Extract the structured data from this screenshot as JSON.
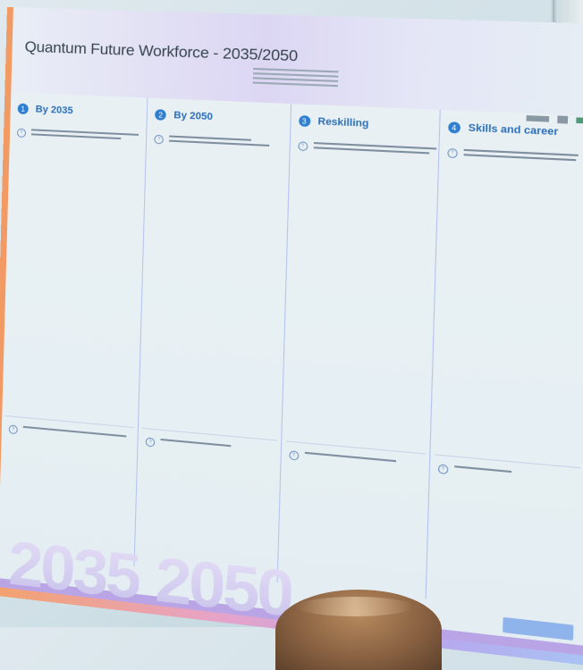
{
  "board": {
    "title": "Quantum Future Workforce - 2035/2050",
    "columns": [
      {
        "number": "1",
        "title": "By 2035"
      },
      {
        "number": "2",
        "title": "By 2050"
      },
      {
        "number": "3",
        "title": "Reskilling"
      },
      {
        "number": "4",
        "title": "Skills and career"
      }
    ],
    "years": [
      "2035",
      "2050"
    ]
  }
}
